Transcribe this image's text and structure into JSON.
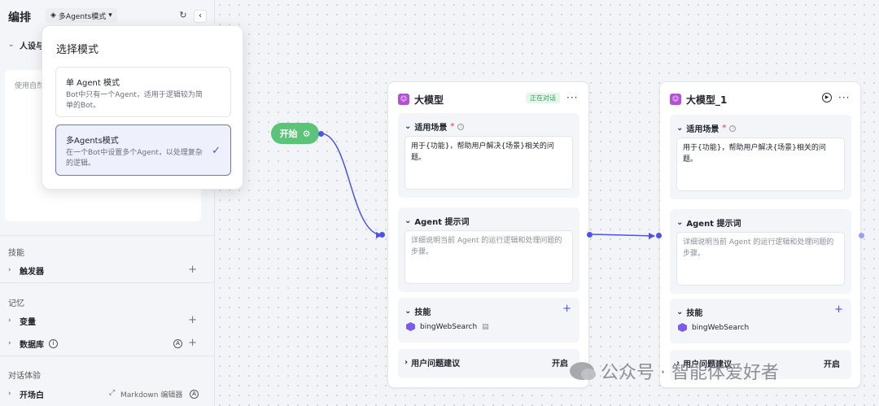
{
  "left": {
    "title": "编排",
    "mode_selector": "多Agents模式",
    "persona_row": "人设与",
    "prompt_placeholder": "使用自然",
    "sections": {
      "skills": "技能",
      "memory": "记忆",
      "chat": "对话体验"
    },
    "rows": {
      "trigger": "触发器",
      "variables": "变量",
      "database": "数据库",
      "opening": "开场白",
      "markdown_editor": "Markdown 编辑器"
    }
  },
  "popup": {
    "title": "选择模式",
    "options": [
      {
        "name": "单 Agent 模式",
        "desc": "Bot中只有一个Agent，适用于逻辑较为简单的Bot。"
      },
      {
        "name": "多Agents模式",
        "desc": "在一个Bot中设置多个Agent，以处理复杂的逻辑。"
      }
    ]
  },
  "start_node": {
    "label": "开始"
  },
  "cards": [
    {
      "title": "大模型",
      "badge": "正在对话",
      "scene_label": "适用场景",
      "scene_text": "用于{功能}，帮助用户解决{场景}相关的问题。",
      "prompt_label": "Agent 提示词",
      "prompt_placeholder": "详细说明当前 Agent 的运行逻辑和处理问题的步骤。",
      "skills_label": "技能",
      "skill_name": "bingWebSearch",
      "suggest_label": "用户问题建议",
      "suggest_value": "开启"
    },
    {
      "title": "大模型_1",
      "scene_label": "适用场景",
      "scene_text": "用于{功能}，帮助用户解决{场景}相关的问题。",
      "prompt_label": "Agent 提示词",
      "prompt_placeholder": "详细说明当前 Agent 的运行逻辑和处理问题的步骤。",
      "skills_label": "技能",
      "skill_name": "bingWebSearch",
      "suggest_label": "用户问题建议",
      "suggest_value": "开启"
    }
  ],
  "watermark": "公众号 · 智能体爱好者",
  "colors": {
    "accent": "#4d53e8",
    "start_green": "#5cc479",
    "badge_green": "#2aa65a",
    "bot_purple": "#b54fd8"
  }
}
